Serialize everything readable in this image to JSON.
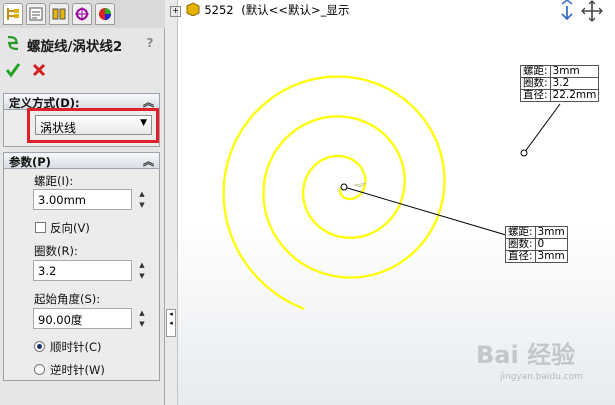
{
  "tree": {
    "part_name": "5252",
    "config": "(默认<<默认>_显示"
  },
  "panel": {
    "title": "螺旋线/涡状线2",
    "help": "?",
    "define_section": {
      "title": "定义方式(D):",
      "value": "涡状线"
    },
    "params_section": {
      "title": "参数(P)",
      "pitch_label": "螺距(I):",
      "pitch_value": "3.00mm",
      "reverse_label": "反向(V)",
      "revolutions_label": "圈数(R):",
      "revolutions_value": "3.2",
      "start_angle_label": "起始角度(S):",
      "start_angle_value": "90.00度",
      "clockwise_label": "顺时针(C)",
      "counterclockwise_label": "逆时针(W)"
    }
  },
  "callout_outer": {
    "rows": [
      [
        "螺距:",
        "3mm"
      ],
      [
        "圈数:",
        "3.2"
      ],
      [
        "直径:",
        "22.2mm"
      ]
    ]
  },
  "callout_inner": {
    "rows": [
      [
        "螺距:",
        "3mm"
      ],
      [
        "圈数:",
        "0"
      ],
      [
        "直径:",
        "3mm"
      ]
    ]
  },
  "watermark": {
    "text": "Bai 经验",
    "sub": "jingyan.baidu.com"
  },
  "colors": {
    "spiral": "#ffff00",
    "highlight": "#e0202a"
  }
}
